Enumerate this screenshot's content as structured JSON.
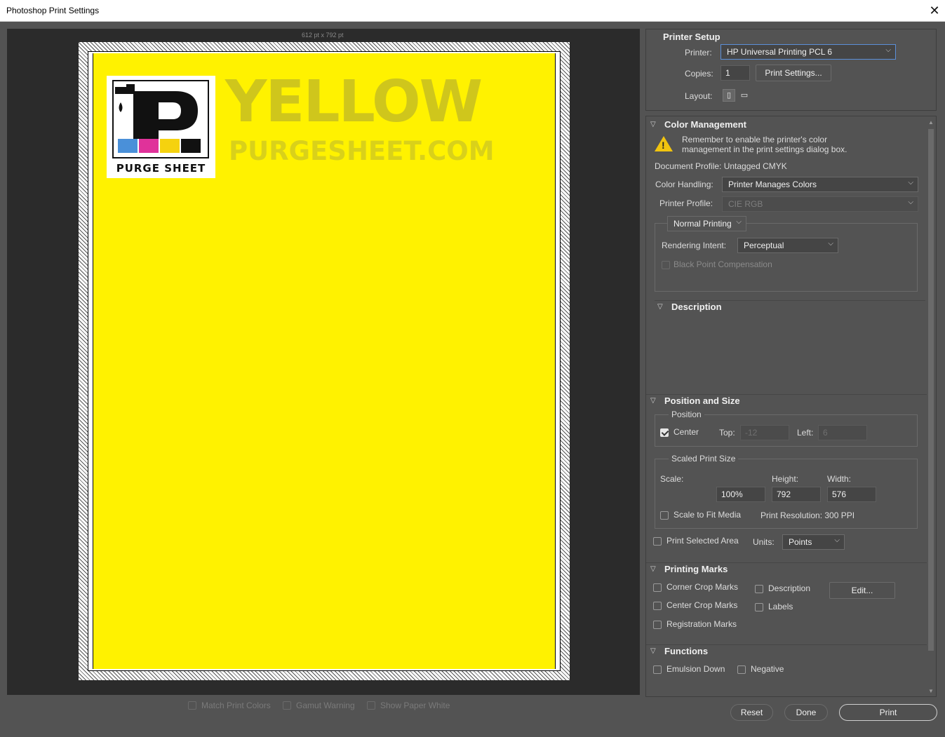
{
  "window": {
    "title": "Photoshop Print Settings"
  },
  "preview": {
    "dimensions": "612 pt x 792 pt",
    "logo_text": "PURGE SHEET",
    "headline": "YELLOW",
    "subline": "PURGESHEET.COM",
    "checks": [
      {
        "label": "Match Print Colors",
        "checked": false
      },
      {
        "label": "Gamut Warning",
        "checked": false
      },
      {
        "label": "Show Paper White",
        "checked": false
      }
    ]
  },
  "printer_setup": {
    "header": "Printer Setup",
    "printer_label": "Printer:",
    "printer_value": "HP Universal Printing PCL 6",
    "copies_label": "Copies:",
    "copies_value": "1",
    "print_settings_button": "Print Settings...",
    "layout_label": "Layout:"
  },
  "color_management": {
    "header": "Color Management",
    "warning": "Remember to enable the printer's color management in the print settings dialog box.",
    "warning_line1": "Remember to enable the printer's color",
    "warning_line2": "management in the print settings dialog box.",
    "document_profile": "Document Profile: Untagged CMYK",
    "color_handling_label": "Color Handling:",
    "color_handling_value": "Printer Manages Colors",
    "printer_profile_label": "Printer Profile:",
    "printer_profile_value": "CIE RGB",
    "printing_mode": "Normal Printing",
    "rendering_intent_label": "Rendering Intent:",
    "rendering_intent_value": "Perceptual",
    "black_point": "Black Point Compensation"
  },
  "description": {
    "header": "Description"
  },
  "position_size": {
    "header": "Position and Size",
    "position_label": "Position",
    "center_label": "Center",
    "top_label": "Top:",
    "top_value": "-12",
    "left_label": "Left:",
    "left_value": "6",
    "scaled_label": "Scaled Print Size",
    "scale_label": "Scale:",
    "scale_value": "100%",
    "height_label": "Height:",
    "height_value": "792",
    "width_label": "Width:",
    "width_value": "576",
    "scale_to_fit": "Scale to Fit Media",
    "resolution": "Print Resolution: 300 PPI",
    "print_selected": "Print Selected Area",
    "units_label": "Units:",
    "units_value": "Points"
  },
  "printing_marks": {
    "header": "Printing Marks",
    "corner_crop": "Corner Crop Marks",
    "center_crop": "Center Crop Marks",
    "registration": "Registration Marks",
    "description": "Description",
    "labels": "Labels",
    "edit_button": "Edit..."
  },
  "functions": {
    "header": "Functions",
    "emulsion_down": "Emulsion Down",
    "negative": "Negative"
  },
  "footer": {
    "reset": "Reset",
    "done": "Done",
    "print": "Print"
  }
}
